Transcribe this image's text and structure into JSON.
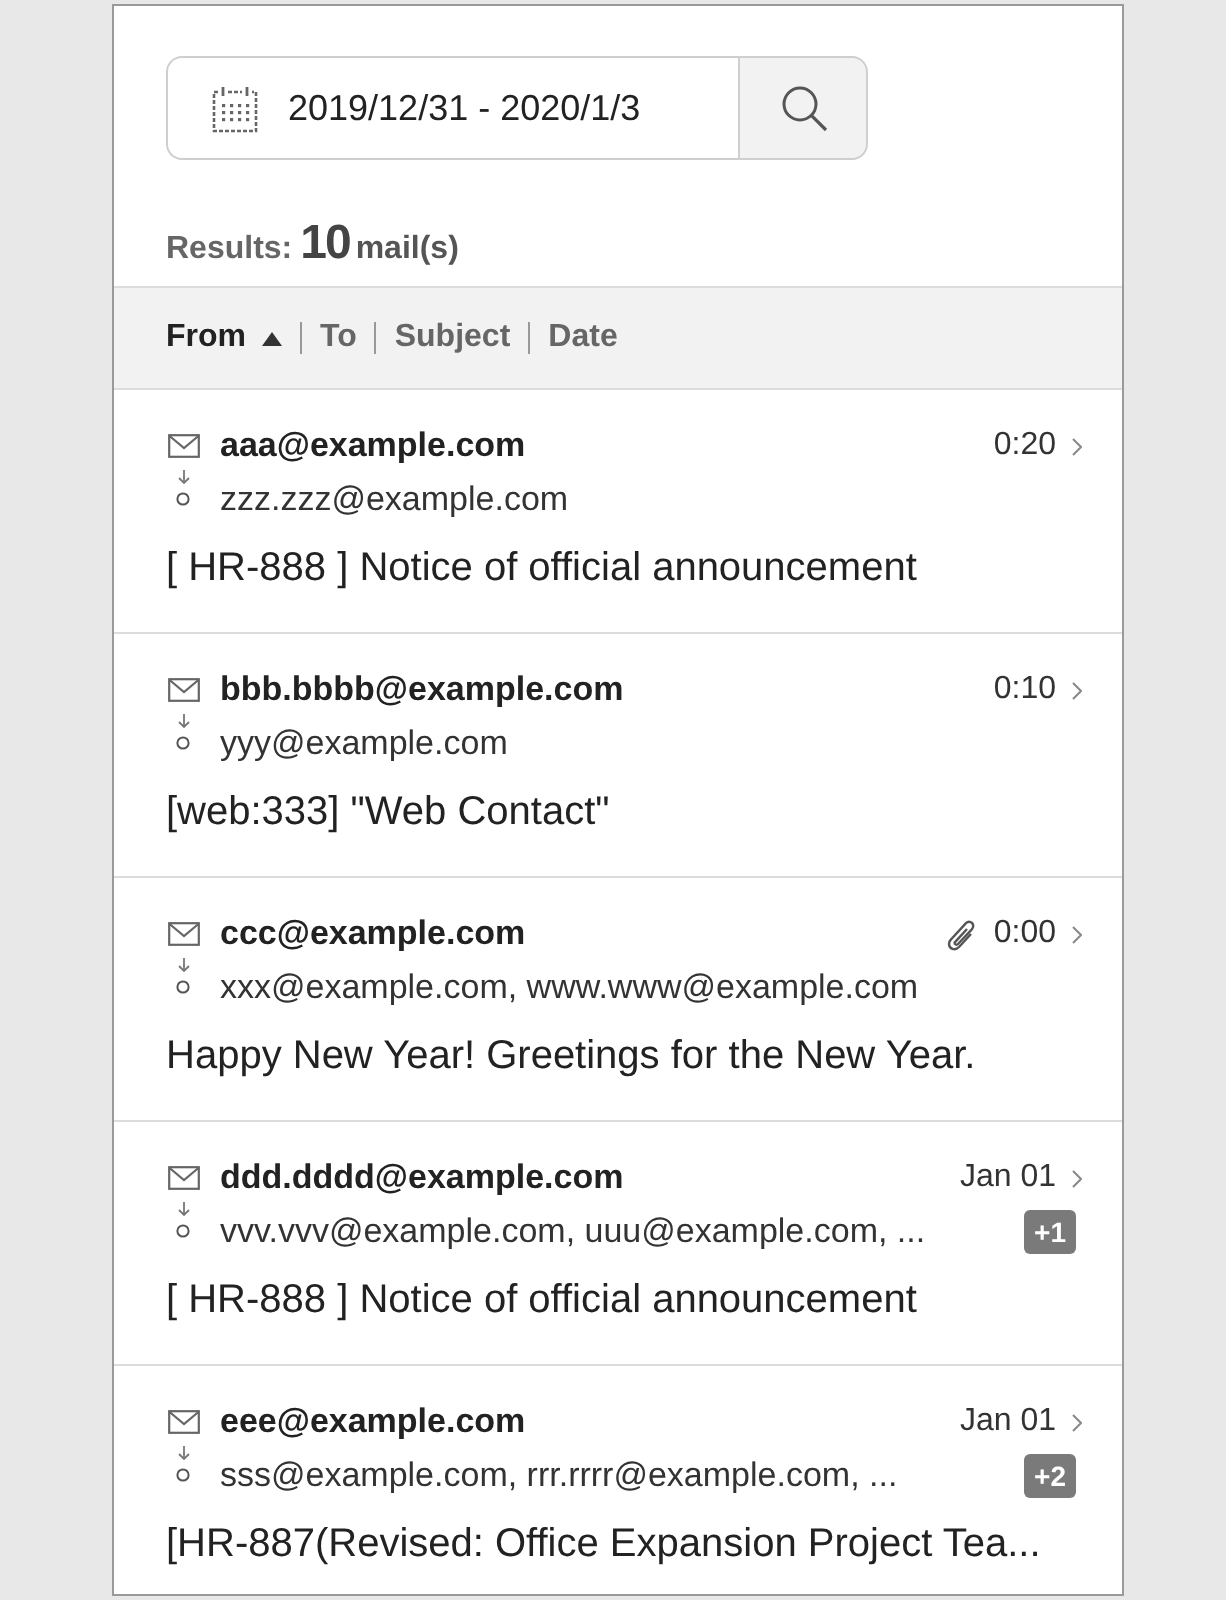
{
  "search": {
    "date_range": "2019/12/31 - 2020/1/3"
  },
  "results": {
    "label": "Results:",
    "count": "10",
    "unit": "mail(s)"
  },
  "sort_columns": [
    {
      "label": "From",
      "selected": true
    },
    {
      "label": "To",
      "selected": false
    },
    {
      "label": "Subject",
      "selected": false
    },
    {
      "label": "Date",
      "selected": false
    }
  ],
  "mails": [
    {
      "from": "aaa@example.com",
      "to": "zzz.zzz@example.com",
      "time": "0:20",
      "attachment": false,
      "subject": "[ HR-888 ] Notice of official announcement"
    },
    {
      "from": "bbb.bbbb@example.com",
      "to": "yyy@example.com",
      "time": "0:10",
      "attachment": false,
      "subject": "[web:333] \"Web Contact\""
    },
    {
      "from": "ccc@example.com",
      "to": "xxx@example.com, www.www@example.com",
      "time": "0:00",
      "attachment": true,
      "subject": "Happy New Year! Greetings for the New Year."
    },
    {
      "from": "ddd.dddd@example.com",
      "to": "vvv.vvv@example.com, uuu@example.com, ...",
      "more": "+1",
      "time": "Jan 01",
      "attachment": false,
      "subject": "[ HR-888 ] Notice of official announcement"
    },
    {
      "from": "eee@example.com",
      "to": "sss@example.com, rrr.rrrr@example.com, ...",
      "more": "+2",
      "time": "Jan 01",
      "attachment": false,
      "subject": "[HR-887(Revised: Office Expansion Project Tea..."
    }
  ]
}
